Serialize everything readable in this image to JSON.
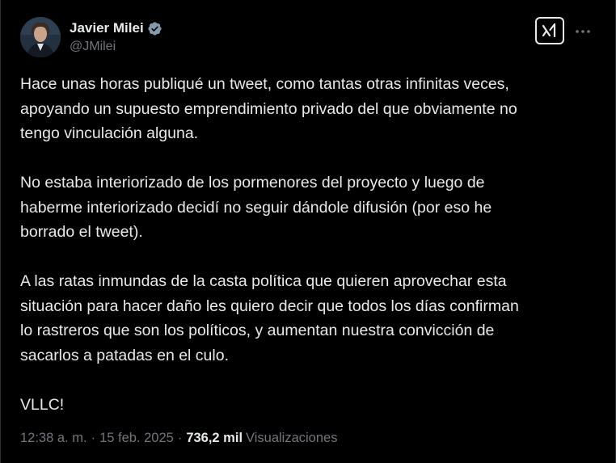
{
  "author": {
    "display_name": "Javier Milei",
    "handle": "@JMilei",
    "verified": true,
    "verified_color": "#829aab"
  },
  "header": {
    "grok_icon": "grok-icon",
    "more_icon": "more-options-icon"
  },
  "tweet": {
    "lines": [
      "Hace unas horas publiqué un tweet, como tantas otras infinitas veces,",
      "apoyando un supuesto emprendimiento privado del que obviamente no",
      "tengo vinculación alguna.",
      "",
      "No estaba interiorizado de los pormenores del proyecto y luego de",
      "haberme interiorizado decidí no seguir dándole difusión (por eso he",
      "borrado el tweet).",
      "",
      "A las ratas inmundas de la casta política que quieren aprovechar esta",
      "situación para hacer daño les quiero decir que todos los días confirman",
      "lo rastreros que son los políticos, y aumentan nuestra convicción de",
      "sacarlos a patadas en el culo.",
      "",
      "VLLC!"
    ]
  },
  "meta": {
    "time": "12:38 a. m.",
    "separator": "·",
    "date": "15 feb. 2025",
    "views_count": "736,2 mil",
    "views_label": "Visualizaciones"
  },
  "colors": {
    "background": "#000000",
    "text": "#e7e9ea",
    "muted": "#71767b"
  }
}
